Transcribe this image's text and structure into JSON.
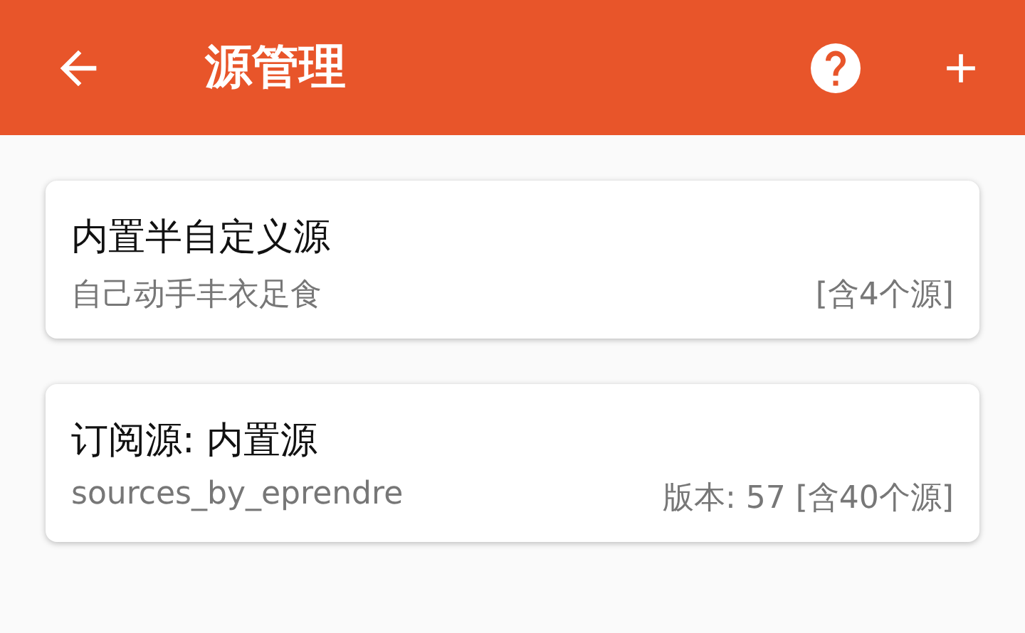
{
  "app_bar": {
    "title": "源管理"
  },
  "sources": [
    {
      "title": "内置半自定义源",
      "subtitle": "自己动手丰衣足食",
      "info": "[含4个源]"
    },
    {
      "title": "订阅源: 内置源",
      "subtitle": "sources_by_eprendre",
      "info": "版本: 57 [含40个源]"
    }
  ]
}
